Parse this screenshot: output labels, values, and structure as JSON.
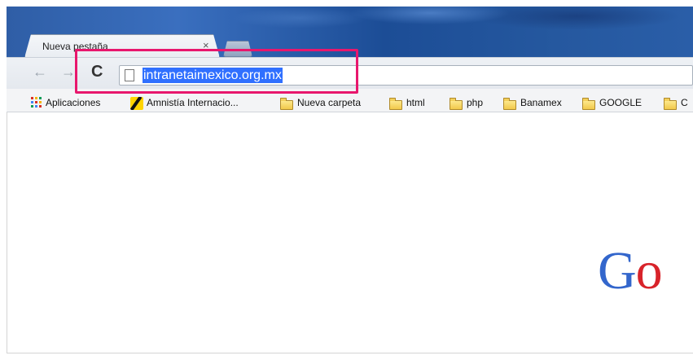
{
  "tab": {
    "title": "Nueva pestaña",
    "close_symbol": "×"
  },
  "toolbar": {
    "back_symbol": "←",
    "forward_symbol": "→",
    "reload_symbol": "C",
    "url": "intranetaimexico.org.mx"
  },
  "bookmarks": {
    "items": [
      {
        "label": "Aplicaciones",
        "icon": "apps-grid-icon"
      },
      {
        "label": "Amnistía Internacio...",
        "icon": "amnesty-icon"
      },
      {
        "label": "Nueva carpeta",
        "icon": "folder-icon"
      },
      {
        "label": "html",
        "icon": "folder-icon"
      },
      {
        "label": "php",
        "icon": "folder-icon"
      },
      {
        "label": "Banamex",
        "icon": "folder-icon"
      },
      {
        "label": "GOOGLE",
        "icon": "folder-icon"
      },
      {
        "label": "C",
        "icon": "folder-icon"
      }
    ]
  },
  "page": {
    "logo_letters": [
      {
        "char": "G",
        "color": "#3366cc"
      },
      {
        "char": "o",
        "color": "#d8232a"
      }
    ]
  },
  "colors": {
    "highlight_box": "#e8176d",
    "url_selection": "#3070ff",
    "titlebar": "#2a5ea8"
  }
}
